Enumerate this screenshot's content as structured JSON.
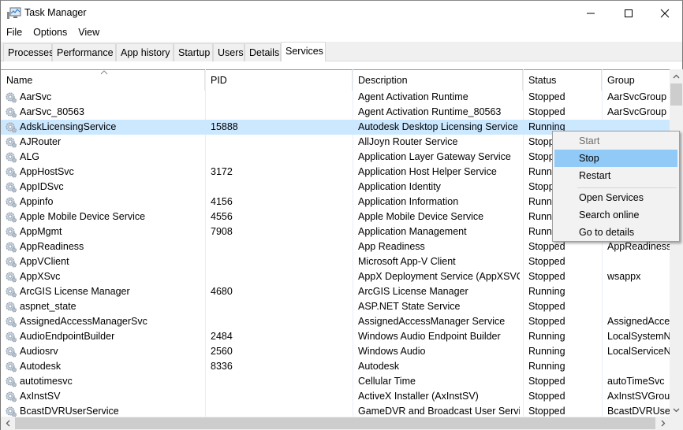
{
  "window": {
    "title": "Task Manager",
    "controls": {
      "minimize": "—",
      "maximize": "☐",
      "close": "✕"
    }
  },
  "menu": [
    "File",
    "Options",
    "View"
  ],
  "tabs": [
    {
      "label": "Processes",
      "active": false
    },
    {
      "label": "Performance",
      "active": false
    },
    {
      "label": "App history",
      "active": false
    },
    {
      "label": "Startup",
      "active": false
    },
    {
      "label": "Users",
      "active": false
    },
    {
      "label": "Details",
      "active": false
    },
    {
      "label": "Services",
      "active": true
    }
  ],
  "columns": {
    "name": "Name",
    "pid": "PID",
    "description": "Description",
    "status": "Status",
    "group": "Group",
    "sorted_by": "name",
    "sort_direction": "ascending"
  },
  "services": [
    {
      "name": "AarSvc",
      "pid": "",
      "description": "Agent Activation Runtime",
      "status": "Stopped",
      "group": "AarSvcGroup"
    },
    {
      "name": "AarSvc_80563",
      "pid": "",
      "description": "Agent Activation Runtime_80563",
      "status": "Stopped",
      "group": "AarSvcGroup"
    },
    {
      "name": "AdskLicensingService",
      "pid": "15888",
      "description": "Autodesk Desktop Licensing Service",
      "status": "Running",
      "group": "",
      "selected": true
    },
    {
      "name": "AJRouter",
      "pid": "",
      "description": "AllJoyn Router Service",
      "status": "Stopped",
      "group": ""
    },
    {
      "name": "ALG",
      "pid": "",
      "description": "Application Layer Gateway Service",
      "status": "Stopped",
      "group": ""
    },
    {
      "name": "AppHostSvc",
      "pid": "3172",
      "description": "Application Host Helper Service",
      "status": "Running",
      "group": ""
    },
    {
      "name": "AppIDSvc",
      "pid": "",
      "description": "Application Identity",
      "status": "Stopped",
      "group": ""
    },
    {
      "name": "Appinfo",
      "pid": "4156",
      "description": "Application Information",
      "status": "Running",
      "group": ""
    },
    {
      "name": "Apple Mobile Device Service",
      "pid": "4556",
      "description": "Apple Mobile Device Service",
      "status": "Running",
      "group": ""
    },
    {
      "name": "AppMgmt",
      "pid": "7908",
      "description": "Application Management",
      "status": "Running",
      "group": ""
    },
    {
      "name": "AppReadiness",
      "pid": "",
      "description": "App Readiness",
      "status": "Stopped",
      "group": "AppReadiness"
    },
    {
      "name": "AppVClient",
      "pid": "",
      "description": "Microsoft App-V Client",
      "status": "Stopped",
      "group": ""
    },
    {
      "name": "AppXSvc",
      "pid": "",
      "description": "AppX Deployment Service (AppXSVC)",
      "status": "Stopped",
      "group": "wsappx"
    },
    {
      "name": "ArcGIS License Manager",
      "pid": "4680",
      "description": "ArcGIS License Manager",
      "status": "Running",
      "group": ""
    },
    {
      "name": "aspnet_state",
      "pid": "",
      "description": "ASP.NET State Service",
      "status": "Stopped",
      "group": ""
    },
    {
      "name": "AssignedAccessManagerSvc",
      "pid": "",
      "description": "AssignedAccessManager Service",
      "status": "Stopped",
      "group": "AssignedAcce.."
    },
    {
      "name": "AudioEndpointBuilder",
      "pid": "2484",
      "description": "Windows Audio Endpoint Builder",
      "status": "Running",
      "group": "LocalSystemN.."
    },
    {
      "name": "Audiosrv",
      "pid": "2560",
      "description": "Windows Audio",
      "status": "Running",
      "group": "LocalServiceN.."
    },
    {
      "name": "Autodesk",
      "pid": "8336",
      "description": "Autodesk",
      "status": "Running",
      "group": ""
    },
    {
      "name": "autotimesvc",
      "pid": "",
      "description": "Cellular Time",
      "status": "Stopped",
      "group": "autoTimeSvc"
    },
    {
      "name": "AxInstSV",
      "pid": "",
      "description": "ActiveX Installer (AxInstSV)",
      "status": "Stopped",
      "group": "AxInstSVGroup"
    },
    {
      "name": "BcastDVRUserService",
      "pid": "",
      "description": "GameDVR and Broadcast User Service",
      "status": "Stopped",
      "group": "BcastDVRUser.."
    }
  ],
  "context_menu": {
    "items": [
      {
        "label": "Start",
        "disabled": true,
        "highlighted": false
      },
      {
        "label": "Stop",
        "disabled": false,
        "highlighted": true
      },
      {
        "label": "Restart",
        "disabled": false,
        "highlighted": false
      },
      {
        "label": "Open Services",
        "disabled": false,
        "highlighted": false
      },
      {
        "label": "Search online",
        "disabled": false,
        "highlighted": false
      },
      {
        "label": "Go to details",
        "disabled": false,
        "highlighted": false
      }
    ]
  },
  "scrollbars": {
    "vertical": {
      "up": "▲",
      "down": "▼"
    },
    "horizontal": {
      "left": "◀",
      "right": "▶"
    }
  },
  "colors": {
    "selected_row": "#cce8ff",
    "menu_highlight": "#91c9f7"
  }
}
